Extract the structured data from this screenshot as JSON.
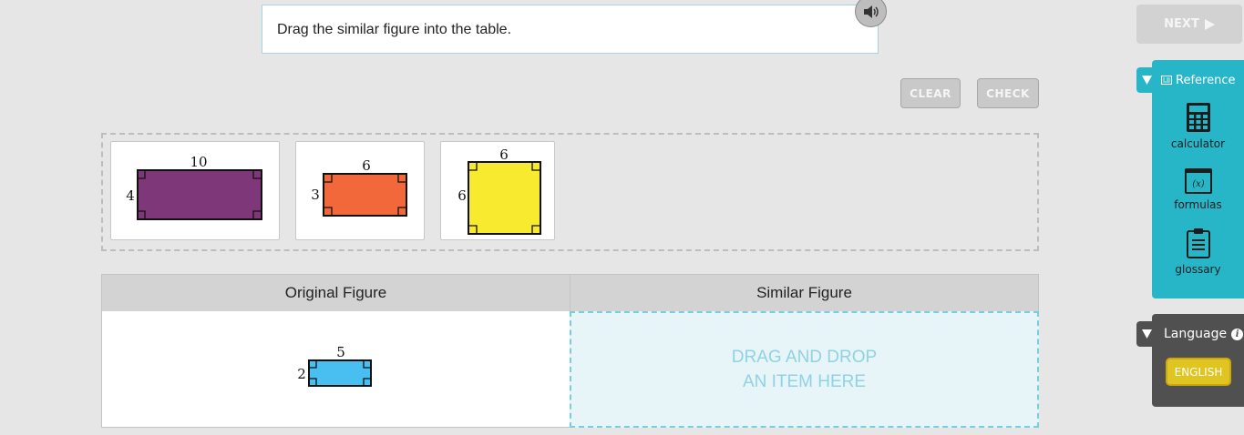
{
  "prompt": {
    "text": "Drag the similar figure into the table."
  },
  "audio": {
    "icon": "speaker-icon"
  },
  "toolbar": {
    "next_label": "NEXT",
    "clear_label": "CLEAR",
    "check_label": "CHECK"
  },
  "answer_bank": {
    "cards": [
      {
        "top_label": "10",
        "side_label": "4",
        "color": "#7e3779"
      },
      {
        "top_label": "6",
        "side_label": "3",
        "color": "#f2683a"
      },
      {
        "top_label": "6",
        "side_label": "6",
        "color": "#f8eb2f"
      }
    ]
  },
  "table": {
    "headers": [
      "Original Figure",
      "Similar Figure"
    ],
    "original": {
      "top_label": "5",
      "side_label": "2",
      "color": "#48bff0"
    },
    "drop_line1": "DRAG AND DROP",
    "drop_line2": "AN ITEM HERE"
  },
  "reference": {
    "title": "Reference",
    "tools": [
      {
        "label": "calculator",
        "icon": "calculator-icon"
      },
      {
        "label": "formulas",
        "icon": "formulas-icon"
      },
      {
        "label": "glossary",
        "icon": "glossary-icon"
      }
    ]
  },
  "language": {
    "title": "Language",
    "current": "ENGLISH"
  },
  "colors": {
    "accent": "#26b6c8",
    "drop_border": "#74cfe0",
    "language_button": "#e0c421"
  }
}
